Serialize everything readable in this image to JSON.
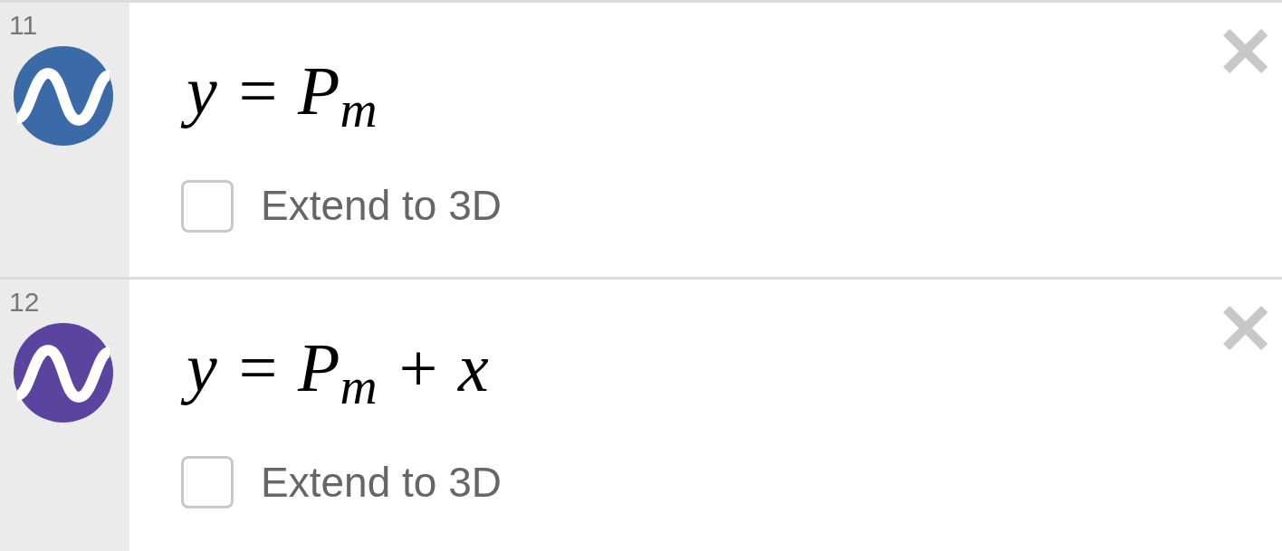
{
  "expressions": [
    {
      "number": "11",
      "color": "#3b6aa8",
      "expression": "y = P$_{m}$",
      "extend_label": "Extend to 3D",
      "extend_checked": false,
      "close": "✕"
    },
    {
      "number": "12",
      "color": "#5a44a0",
      "expression": "y = P$_{m}$ + x",
      "extend_label": "Extend to 3D",
      "extend_checked": false,
      "close": "✕"
    }
  ]
}
